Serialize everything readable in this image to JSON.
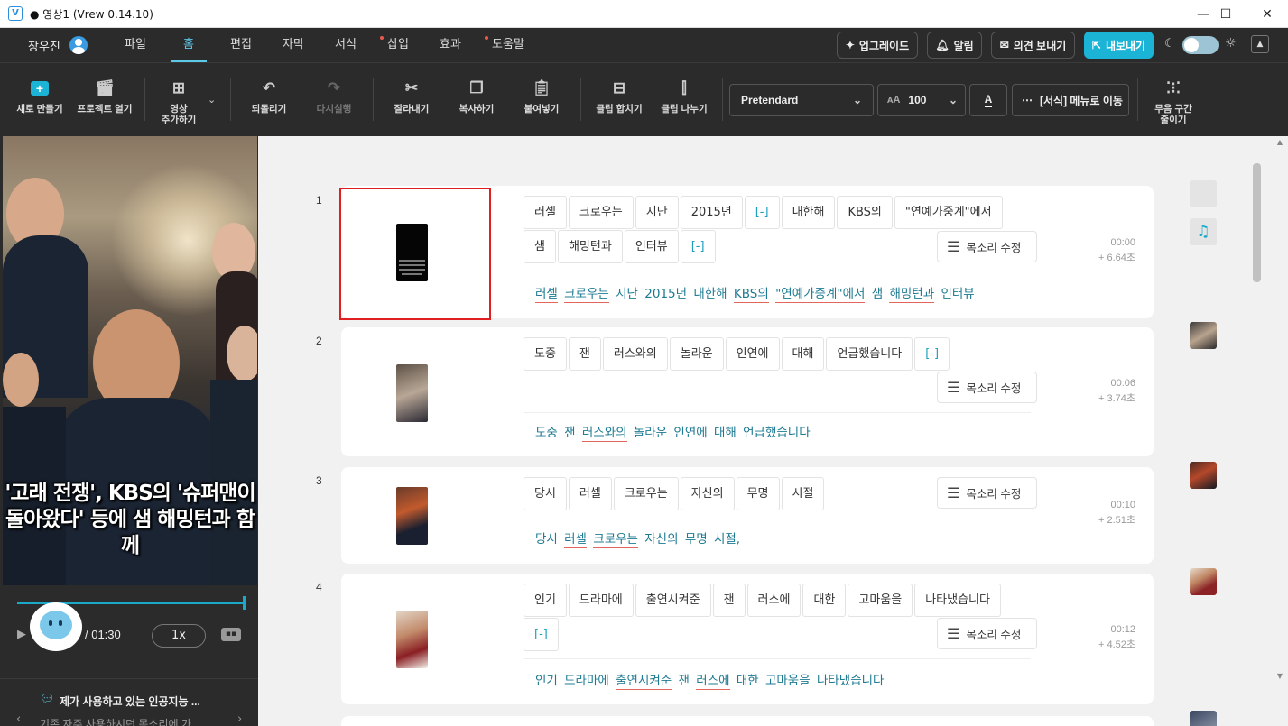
{
  "window": {
    "title": "● 영상1 (Vrew 0.14.10)",
    "logo": "V",
    "minimize": "—",
    "maximize": "☐",
    "close": "✕"
  },
  "menubar": {
    "user": "장우진",
    "tabs": [
      "파일",
      "홈",
      "편집",
      "자막",
      "서식",
      "삽입",
      "효과",
      "도움말"
    ],
    "active_tab": "홈",
    "upgrade": "업그레이드",
    "alerts": "알림",
    "feedback": "의견 보내기",
    "export": "내보내기"
  },
  "toolbar": {
    "new": "새로 만들기",
    "open_project": "프로젝트 열기",
    "add_video": "영상\n추가하기",
    "undo": "되돌리기",
    "redo": "다시실행",
    "cut": "잘라내기",
    "copy": "복사하기",
    "paste": "붙여넣기",
    "merge_clip": "클립 합치기",
    "split_clip": "클립 나누기",
    "font": "Pretendard",
    "font_size": "100",
    "format_menu": "[서식] 메뉴로 이동",
    "silence": "무음 구간\n줄이기"
  },
  "preview": {
    "caption": "'고래 전쟁', KBS의 '슈퍼맨이 돌아왔다' 등에 샘 해밍턴과 함께",
    "time": "/ 01:30",
    "speed": "1x",
    "progress_fraction": 1.0
  },
  "ai_panel": {
    "title": "제가 사용하고 있는 인공지능 ...",
    "subtitle": "기존 자주 사용하시던 목소리에 가"
  },
  "clips": [
    {
      "number": "1",
      "words": [
        "러셀",
        "크로우는",
        "지난",
        "2015년",
        "[-]",
        "내한해",
        "KBS의",
        "\"연예가중계\"에서",
        "샘",
        "해밍턴과",
        "인터뷰",
        "[-]"
      ],
      "voice_label": "목소리 수정",
      "start": "00:00",
      "duration": "+ 6.64초",
      "subtitle": "러셀 크로우는 지난 2015년 내한해 KBS의 \"연예가중계\"에서 샘 해밍턴과 인터뷰"
    },
    {
      "number": "2",
      "words": [
        "도중",
        "잰",
        "러스와의",
        "놀라운",
        "인연에",
        "대해",
        "언급했습니다",
        "[-]"
      ],
      "voice_label": "목소리 수정",
      "start": "00:06",
      "duration": "+ 3.74초",
      "subtitle": "도중 잰 러스와의 놀라운 인연에 대해 언급했습니다"
    },
    {
      "number": "3",
      "words": [
        "당시",
        "러셀",
        "크로우는",
        "자신의",
        "무명",
        "시절"
      ],
      "voice_label": "목소리 수정",
      "start": "00:10",
      "duration": "+ 2.51초",
      "subtitle": "당시 러셀 크로우는 자신의 무명 시절,"
    },
    {
      "number": "4",
      "words": [
        "인기",
        "드라마에",
        "출연시켜준",
        "잰",
        "러스에",
        "대한",
        "고마움을",
        "나타냈습니다",
        "[-]"
      ],
      "voice_label": "목소리 수정",
      "start": "00:12",
      "duration": "+ 4.52초",
      "subtitle": "인기 드라마에 출연시켜준 잰 러스에 대한 고마움을 나타냈습니다"
    }
  ],
  "colors": {
    "accent": "#1aa9c9",
    "dark_bg": "#2b2b2b",
    "selection": "#e02020",
    "underline": "#e3655c"
  }
}
